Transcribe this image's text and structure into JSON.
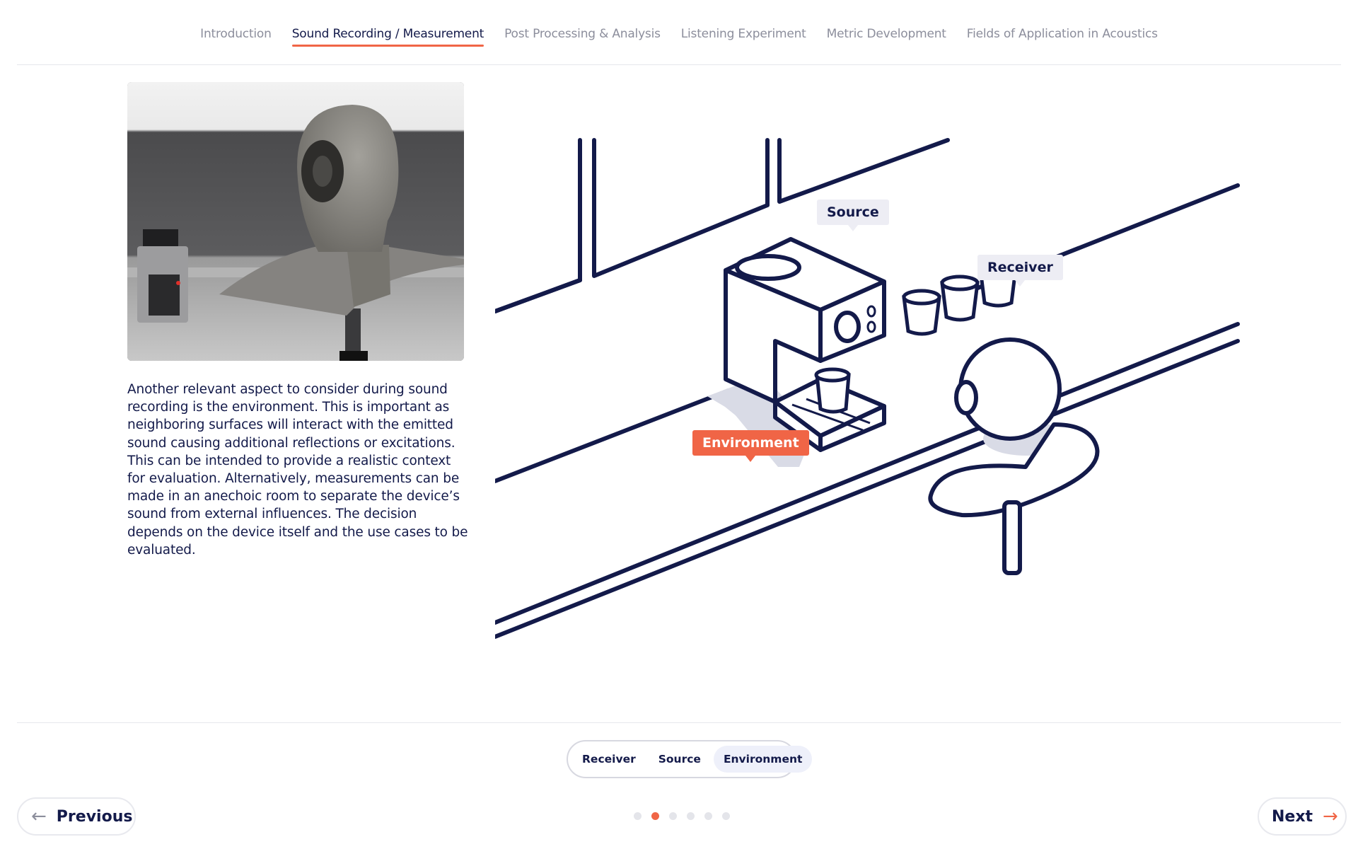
{
  "nav": {
    "tabs": [
      {
        "label": "Introduction"
      },
      {
        "label": "Sound Recording / Measurement"
      },
      {
        "label": "Post Processing & Analysis"
      },
      {
        "label": "Listening Experiment"
      },
      {
        "label": "Metric Development"
      },
      {
        "label": "Fields of Application in Acoustics"
      }
    ],
    "active_tab": "Sound Recording / Measurement"
  },
  "main": {
    "description": "Another relevant aspect to consider during sound recording is the environment. This is important as neighboring surfaces will interact with the emitted sound causing additional reflections or excitations. This can be intended to provide a realistic context for evaluation. Alternatively, measurements can be made in an anechoic room to separate the device’s sound from external influences. The decision depends on the device itself and the use cases to be evaluated.",
    "illustration": {
      "labels": {
        "source": "Source",
        "receiver": "Receiver",
        "environment": "Environment"
      },
      "active_label": "Environment"
    }
  },
  "segmented": {
    "options": [
      {
        "label": "Receiver"
      },
      {
        "label": "Source"
      },
      {
        "label": "Environment"
      }
    ],
    "selected": "Environment"
  },
  "pager": {
    "total": 6,
    "current": 2
  },
  "footer": {
    "previous_label": "Previous",
    "next_label": "Next"
  },
  "colors": {
    "accent": "#f06546",
    "ink": "#131a4a",
    "muted": "#8c8e9c"
  },
  "icons": {
    "previous": "arrow-left-icon",
    "next": "arrow-right-icon"
  }
}
